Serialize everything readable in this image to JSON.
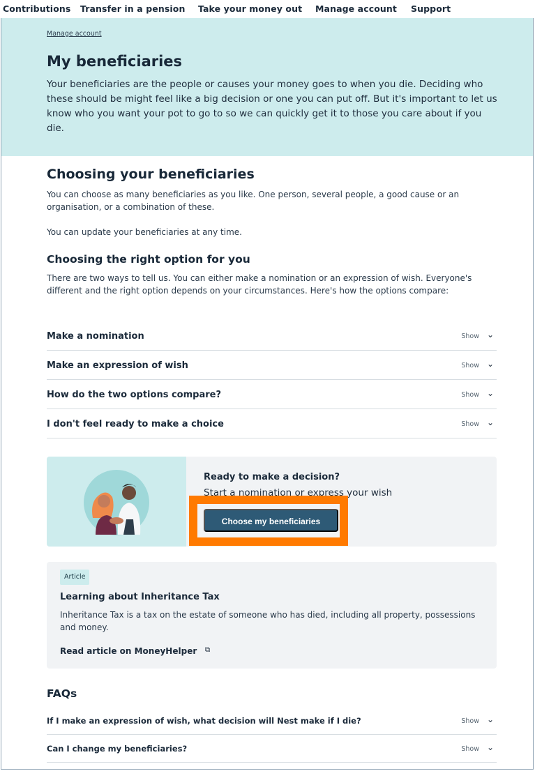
{
  "nav": {
    "items": [
      "Contributions",
      "Transfer in a pension",
      "Take your money out",
      "Manage account",
      "Support"
    ]
  },
  "hero": {
    "breadcrumb": "Manage account",
    "title": "My beneficiaries",
    "intro": "Your beneficiaries are the people or causes your money goes to when you die. Deciding who these should be might feel like a big decision or one you can put off. But it's important to let us know who you want your pot to go to so we can quickly get it to those you care about if you die."
  },
  "choosing": {
    "title": "Choosing your beneficiaries",
    "p1": "You can choose as many beneficiaries as you like. One person, several people, a good cause or an organisation, or a combination of these.",
    "p2": "You can update your beneficiaries at any time."
  },
  "options": {
    "title": "Choosing the right option for you",
    "intro": "There are two ways to tell us. You can either make a nomination or an expression of wish. Everyone's different and the right option depends on your circumstances. Here's how the options compare:",
    "show_label": "Show",
    "accordion": [
      "Make a nomination",
      "Make an expression of wish",
      "How do the two options compare?",
      "I don't feel ready to make a choice"
    ]
  },
  "cta": {
    "question": "Ready to make a decision?",
    "subtitle": "Start a nomination or express your wish",
    "button": "Choose my beneficiaries",
    "highlight_color": "#ff7a00"
  },
  "article": {
    "tag": "Article",
    "title": "Learning about Inheritance Tax",
    "body": "Inheritance Tax is a tax on the estate of someone who has died, including all property, possessions and money.",
    "link": "Read article on MoneyHelper",
    "link_icon": "external-link-icon"
  },
  "faqs": {
    "title": "FAQs",
    "show_label": "Show",
    "items": [
      "If I make an expression of wish, what decision will Nest make if I die?",
      "Can I change my beneficiaries?"
    ]
  },
  "colors": {
    "hero_bg": "#cdeced",
    "button_bg": "#2e5a76",
    "text_dark": "#1b2a3a"
  }
}
